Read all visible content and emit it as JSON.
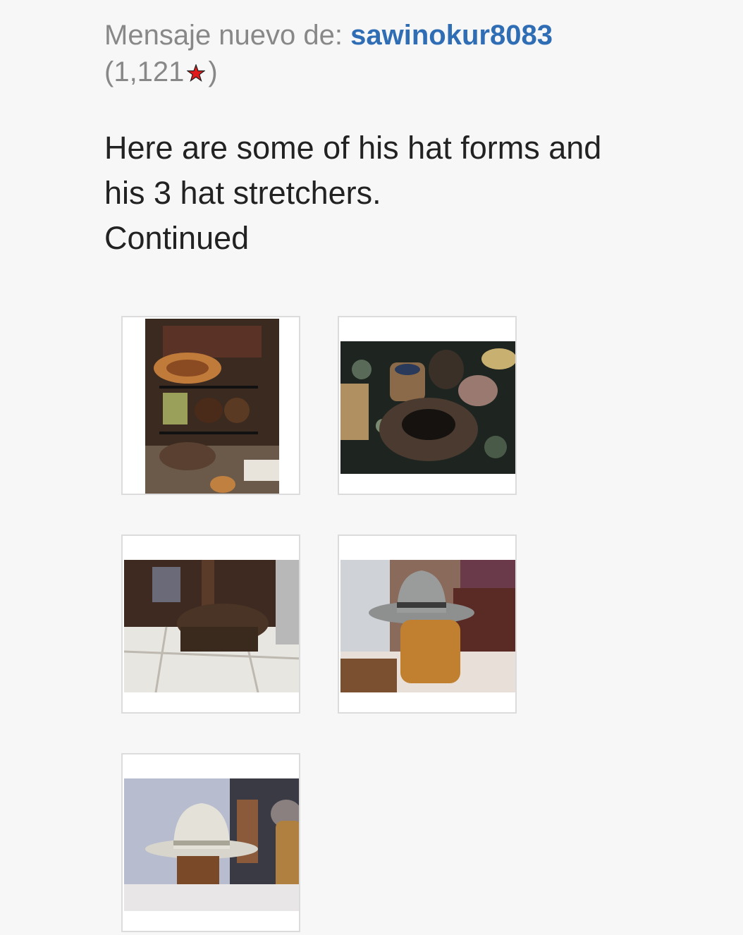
{
  "message": {
    "header_prefix": "Mensaje nuevo de: ",
    "username": "sawinokur8083",
    "score_open": "(1,121",
    "score_close": ")",
    "star_color": "#e0191a",
    "body_line1": "Here are some of his hat forms and",
    "body_line2": "his 3 hat stretchers.",
    "body_line3": "Continued"
  },
  "attachments": [
    {
      "icon": "photo-hat-rack-shelf"
    },
    {
      "icon": "photo-hat-forms-on-rug"
    },
    {
      "icon": "photo-hat-stretcher-on-tile"
    },
    {
      "icon": "photo-gray-hat-on-block"
    },
    {
      "icon": "photo-white-hat-on-stand"
    }
  ],
  "colors": {
    "link": "#2f6db5",
    "muted_text": "#888888",
    "body_text": "#222222",
    "background": "#f7f7f7"
  }
}
